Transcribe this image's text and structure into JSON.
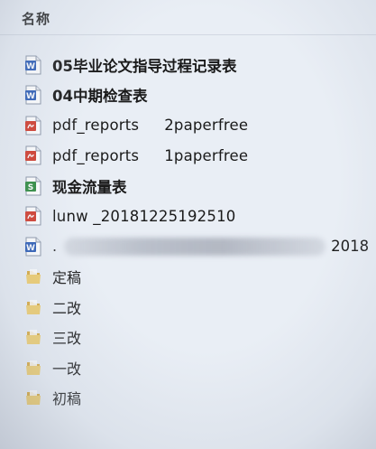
{
  "header": {
    "column_name": "名称"
  },
  "files": [
    {
      "type": "word",
      "icon": "word-doc-icon",
      "name": "05毕业论文指导过程记录表"
    },
    {
      "type": "word",
      "icon": "word-doc-icon",
      "name": "04中期检查表"
    },
    {
      "type": "pdf",
      "icon": "pdf-file-icon",
      "name_a": "pdf_reports",
      "name_b": "2paperfree"
    },
    {
      "type": "pdf",
      "icon": "pdf-file-icon",
      "name_a": "pdf_reports",
      "name_b": "1paperfree"
    },
    {
      "type": "excel",
      "icon": "excel-sheet-icon",
      "name": "现金流量表"
    },
    {
      "type": "pdf",
      "icon": "pdf-file-icon",
      "name": "lunw _20181225192510"
    },
    {
      "type": "word",
      "icon": "word-doc-icon",
      "prefix": ".",
      "suffix": "2018"
    }
  ],
  "folders": [
    {
      "icon": "folder-icon",
      "name": "定稿"
    },
    {
      "icon": "folder-icon",
      "name": "二改"
    },
    {
      "icon": "folder-icon",
      "name": "三改"
    },
    {
      "icon": "folder-icon",
      "name": "一改"
    },
    {
      "icon": "folder-icon",
      "name": "初稿"
    }
  ],
  "colors": {
    "word_blue": "#2a5bb5",
    "pdf_red": "#d23a2a",
    "excel_green": "#2e8b3e",
    "folder_yellow": "#e8c25a",
    "background": "#e9eef5"
  }
}
